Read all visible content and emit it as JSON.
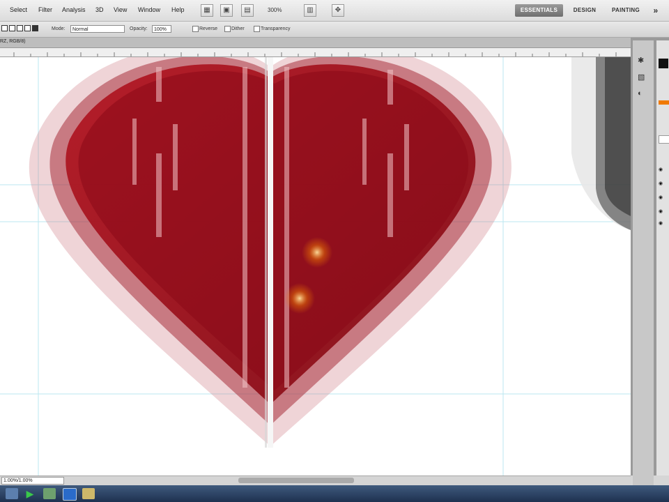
{
  "menubar": {
    "items": [
      "Select",
      "Filter",
      "Analysis",
      "3D",
      "View",
      "Window",
      "Help"
    ],
    "zoom": "300%",
    "workspaces": {
      "essentials": "ESSENTIALS",
      "design": "DESIGN",
      "painting": "PAINTING",
      "more": "»"
    }
  },
  "options": {
    "mode_label": "Mode:",
    "mode_value": "Normal",
    "opacity_label": "Opacity:",
    "opacity_value": "100%",
    "reverse_label": "Reverse",
    "dither_label": "Dither",
    "transparency_label": "Transparency"
  },
  "document": {
    "tab_label": "RZ, RGB/8)"
  },
  "status": {
    "zoom_field": "1.00%/1.00%"
  },
  "colors": {
    "heart_dark": "#8a0a17",
    "heart_light": "#b3131f",
    "guide": "#8fd8e8",
    "accent": "#f07a00"
  }
}
